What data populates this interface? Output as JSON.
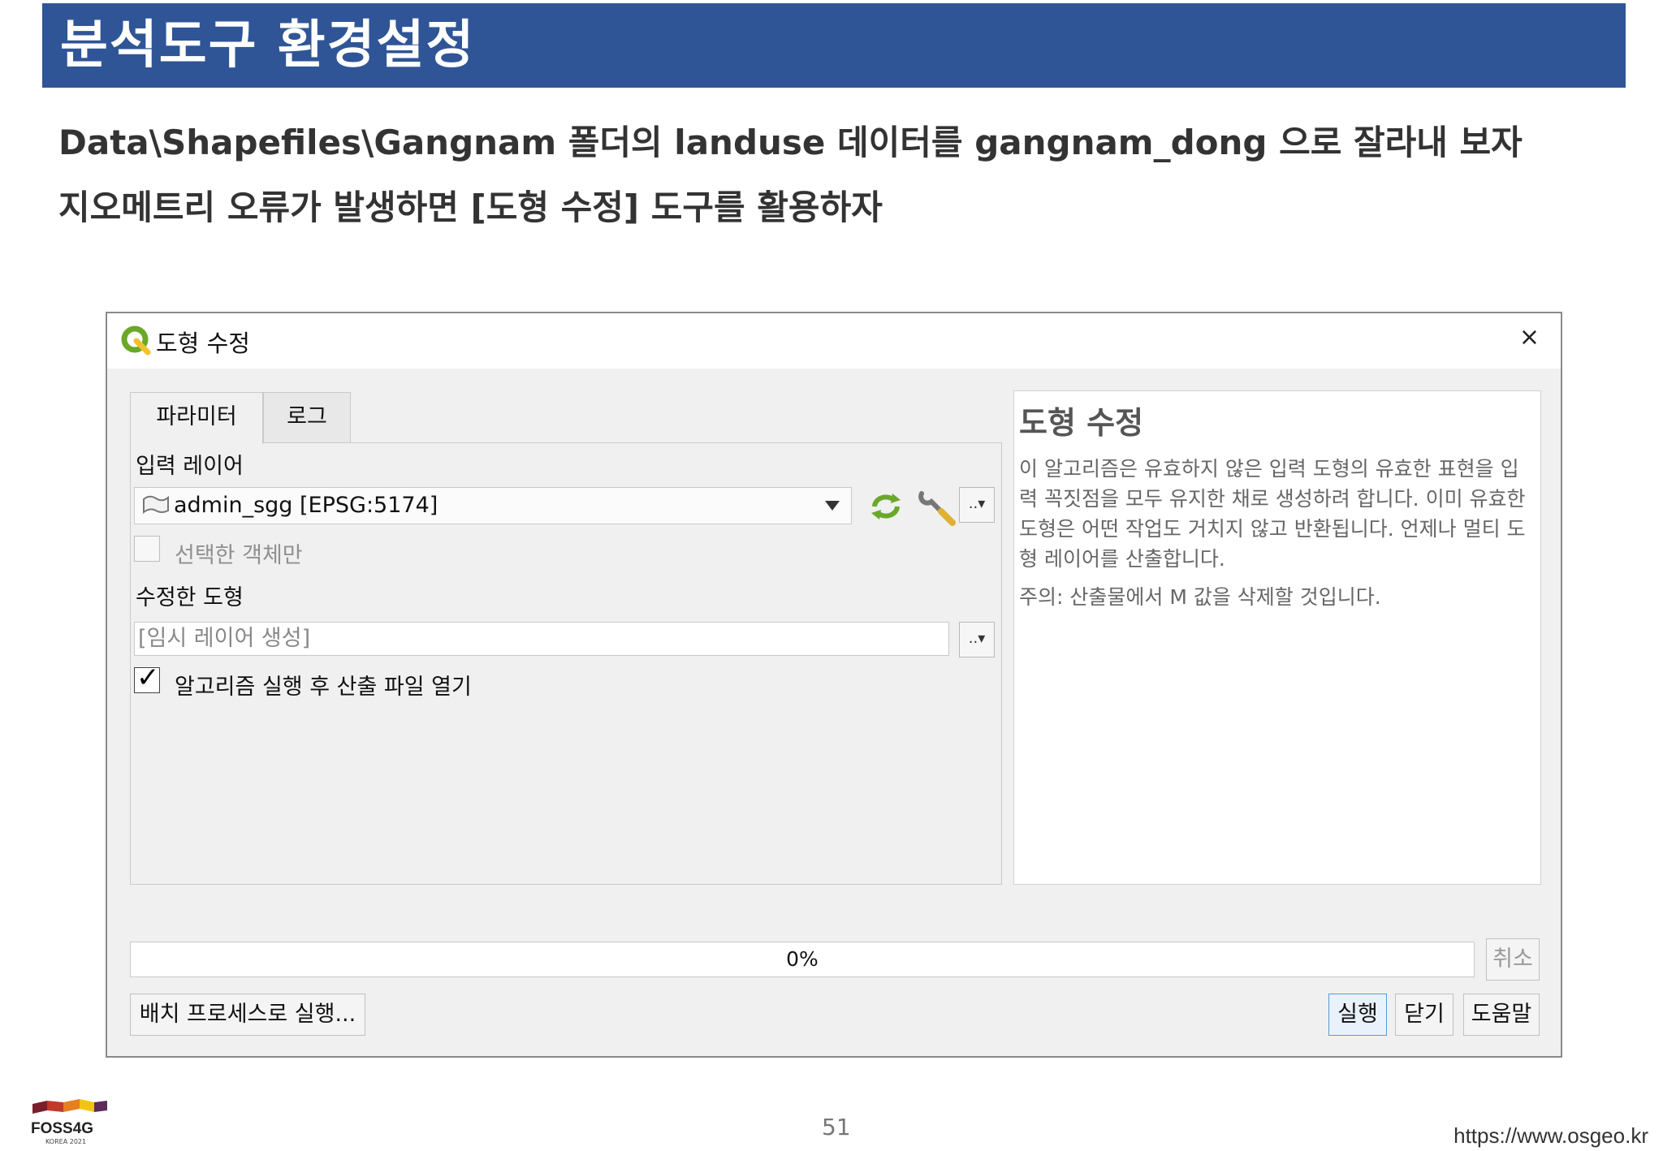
{
  "slide": {
    "title": "분석도구 환경설정",
    "line1": "Data\\Shapefiles\\Gangnam 폴더의 landuse 데이터를 gangnam_dong 으로 잘라내 보자",
    "line2": "지오메트리 오류가 발생하면 [도형 수정] 도구를 활용하자",
    "page_number": "51",
    "url": "https://www.osgeo.kr",
    "logo_text": "FOSS4G",
    "logo_sub": "KOREA 2021"
  },
  "dialog": {
    "title": "도형 수정",
    "close_glyph": "×",
    "tabs": [
      {
        "label": "파라미터",
        "active": true
      },
      {
        "label": "로그",
        "active": false
      }
    ],
    "input_layer_label": "입력 레이어",
    "input_layer_value": "admin_sgg [EPSG:5174]",
    "selected_only_label": "선택한 객체만",
    "output_label": "수정한 도형",
    "output_placeholder": "[임시 레이어 생성]",
    "open_after_label": "알고리즘 실행 후 산출 파일 열기",
    "more_glyph": "..▾",
    "help_title": "도형 수정",
    "help_text": "이 알고리즘은 유효하지 않은 입력 도형의 유효한 표현을 입력 꼭짓점을 모두 유지한 채로 생성하려 합니다. 이미 유효한 도형은 어떤 작업도 거치지 않고 반환됩니다. 언제나 멀티 도형 레이어를 산출합니다.",
    "help_note": "주의: 산출물에서 M 값을 삭제할 것입니다.",
    "progress": 0,
    "progress_text": "0%",
    "cancel_label": "취소",
    "batch_label": "배치 프로세스로 실행...",
    "run_label": "실행",
    "close_label": "닫기",
    "help_label": "도움말"
  },
  "colors": {
    "title_bar": "#2f5597",
    "qgis_green": "#6aa829",
    "qgis_yellow": "#f2c12e"
  }
}
